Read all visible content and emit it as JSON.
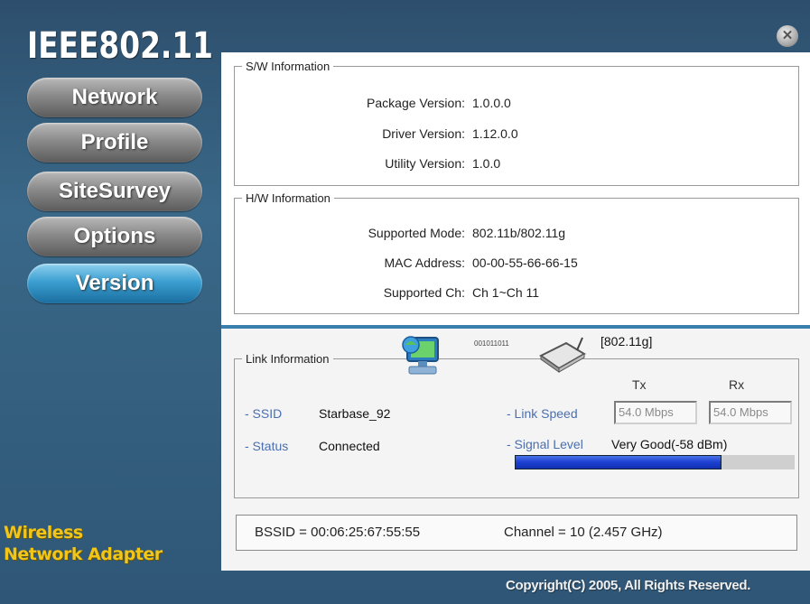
{
  "brand": {
    "title": "IEEE802.11"
  },
  "nav": {
    "items": [
      {
        "label": "Network"
      },
      {
        "label": "Profile"
      },
      {
        "label": "SiteSurvey"
      },
      {
        "label": "Options"
      },
      {
        "label": "Version",
        "active": true
      }
    ]
  },
  "tagline": {
    "line1": "Wireless",
    "line2": "Network Adapter"
  },
  "close_icon": "close-icon",
  "sw": {
    "legend": "S/W Information",
    "rows": [
      {
        "label": "Package Version:",
        "value": "1.0.0.0"
      },
      {
        "label": "Driver Version:",
        "value": "1.12.0.0"
      },
      {
        "label": "Utility Version:",
        "value": "1.0.0"
      }
    ]
  },
  "hw": {
    "legend": "H/W Information",
    "rows": [
      {
        "label": "Supported Mode:",
        "value": "802.11b/802.11g"
      },
      {
        "label": "MAC Address:",
        "value": "00-00-55-66-66-15"
      },
      {
        "label": "Supported Ch:",
        "value": "Ch 1~Ch 11"
      }
    ]
  },
  "link": {
    "legend": "Link Information",
    "bits_text": "001011011",
    "band": "[802.11g]",
    "ssid_label": "- SSID",
    "ssid_value": "Starbase_92",
    "status_label": "- Status",
    "status_value": "Connected",
    "tx_head": "Tx",
    "rx_head": "Rx",
    "speed_label": "- Link Speed",
    "tx_speed": "54.0 Mbps",
    "rx_speed": "54.0 Mbps",
    "signal_label": "- Signal Level",
    "signal_value": "Very Good(-58 dBm)",
    "signal_fraction": 0.74
  },
  "bssid": {
    "text": "BSSID = 00:06:25:67:55:55",
    "channel": "Channel = 10 (2.457 GHz)"
  },
  "footer": {
    "copyright": "Copyright(C) 2005, All Rights Reserved."
  },
  "colors": {
    "accent": "#3c9fd1",
    "tagline": "#f2c619",
    "signal": "#1c3fd1"
  }
}
